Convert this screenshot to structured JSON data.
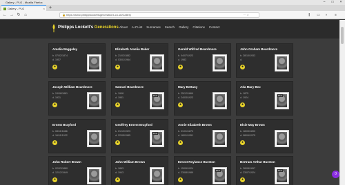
{
  "browser": {
    "window_title": "Gallery - PLG - Mozilla Firefox",
    "tab_title": "Gallery - PLG",
    "tab_close": "×",
    "new_tab": "+",
    "url": "https://www.philippslockettsgenerations.co.uk/Gallery",
    "url_actions": "··· ☆",
    "min": "–",
    "max": "□",
    "close": "×"
  },
  "site": {
    "brand_white": "Philipps Lockett's",
    "brand_yellow": "Generations",
    "menu": [
      "About",
      "A-Z List",
      "Surnames",
      "Search",
      "Gallery",
      "Citations",
      "Contact"
    ]
  },
  "cards": [
    {
      "name": "Amelia Baggaley",
      "born": "b. 07/02/1874",
      "died": "d. 1957",
      "tag": ""
    },
    {
      "name": "Elizabeth Amelia Baker",
      "born": "b. 21/02/1882",
      "died": "d. 03/01/1964",
      "tag": ""
    },
    {
      "name": "Gerald Wilfred Beardmore",
      "born": "b. 04/07/1923",
      "died": "d. 1983",
      "tag": ""
    },
    {
      "name": "John Graham Beardmore",
      "born": "b. 28/10/1933",
      "died": "d.",
      "tag": ""
    },
    {
      "name": "Joseph William Beardmore",
      "born": "b. 24/08/1881",
      "died": "d. 1931",
      "tag": ""
    },
    {
      "name": "Samuel Beardmore",
      "born": "b. 1908",
      "died": "d. 1951",
      "tag": "PLG"
    },
    {
      "name": "Mary Bettany",
      "born": "b. 25/12/1869",
      "died": "d. 24/03/1923",
      "tag": ""
    },
    {
      "name": "Ada Mary Bex",
      "born": "b. 1875",
      "died": "d. 1924",
      "tag": "PLG"
    },
    {
      "name": "Ernest Brayford",
      "born": "b. 08/11/1886",
      "died": "d. 16/11/1922",
      "tag": ""
    },
    {
      "name": "Geoffrey Ernest Brayford",
      "born": "b. 21/12/1923",
      "died": "d. 22/05/1985",
      "tag": "PLG"
    },
    {
      "name": "Annie Elizabeth Brown",
      "born": "b. 01/01/1870",
      "died": "d. 18/01/1951",
      "tag": ""
    },
    {
      "name": "Elsie May Brown",
      "born": "b. 18/03/1890",
      "died": "d. 08/04/1975",
      "tag": ""
    },
    {
      "name": "John Robert Brown",
      "born": "b. 02/03/1880",
      "died": "d. 12/12/1949",
      "tag": ""
    },
    {
      "name": "John William Brown",
      "born": "b. 1863",
      "died": "d. 1943",
      "tag": ""
    },
    {
      "name": "Ernest Roylance Burston",
      "born": "b. 15/09/1924",
      "died": "d. 23/08/1989",
      "tag": "PLG"
    },
    {
      "name": "Bertram Arthur Burston",
      "born": "b. 28/08/1897",
      "died": "d. 23/07/1924",
      "tag": "PLG"
    }
  ],
  "fab_label": "0"
}
